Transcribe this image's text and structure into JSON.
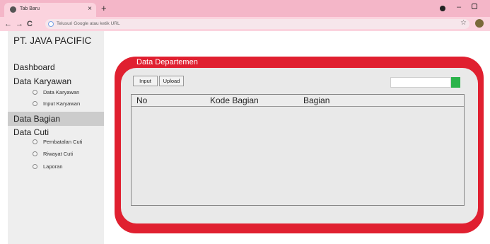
{
  "browser": {
    "tab_title": "Tab Baru",
    "tab_close": "×",
    "new_tab": "+",
    "address_placeholder": "Telusuri Google atau ketik URL",
    "back": "←",
    "forward": "→",
    "reload": "C",
    "star": "☆",
    "minimize": "–"
  },
  "sidebar": {
    "brand": "PT. JAVA PACIFIC",
    "dashboard": "Dashboard",
    "data_karyawan": "Data Karyawan",
    "karyawan_items": [
      "Data Karyawan",
      "Input Karyawan"
    ],
    "data_bagian": "Data Bagian",
    "data_cuti": "Data Cuti",
    "cuti_items": [
      "Pembatalan Cuti",
      "Riwayat Cuti",
      "Laporan"
    ]
  },
  "main": {
    "title": "Data Departemen",
    "buttons": {
      "input": "Input",
      "upload": "Upload"
    },
    "table": {
      "columns": [
        "No",
        "Kode Bagian",
        "Bagian"
      ],
      "rows": []
    }
  },
  "colors": {
    "accent_red": "#e02030",
    "search_green": "#2bb34a",
    "tabbar_pink": "#f4b6c8"
  }
}
